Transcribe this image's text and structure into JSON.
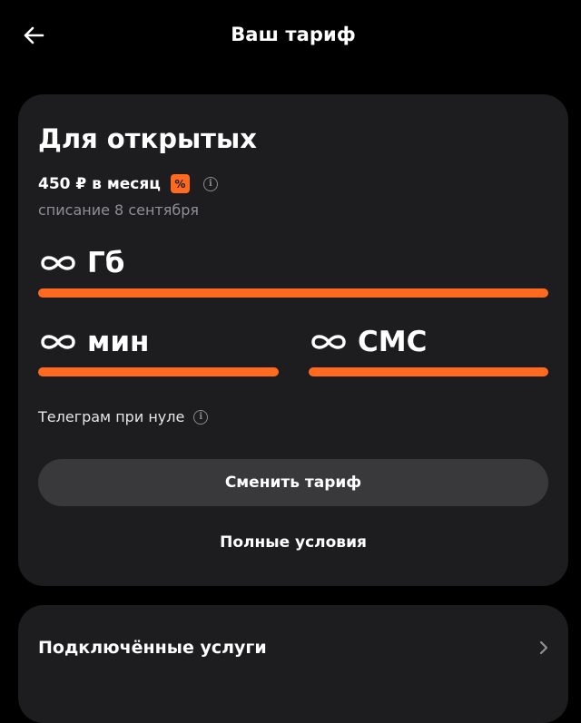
{
  "header": {
    "title": "Ваш тариф"
  },
  "tariff": {
    "name": "Для открытых",
    "price": "450 ₽ в месяц",
    "discount_badge": "%",
    "info_glyph": "i",
    "charge_date": "списание 8 сентября",
    "data_quota": "Гб",
    "minutes_quota": "мин",
    "sms_quota": "СМС",
    "quota_fill": 1.0,
    "perk": "Телеграм при нуле",
    "change_button": "Сменить тариф",
    "terms_link": "Полные условия"
  },
  "services": {
    "title": "Подключённые услуги"
  },
  "colors": {
    "background": "#000000",
    "card": "#1d1d1f",
    "accent": "#ff6a1f",
    "button": "#39393c",
    "muted_text": "#8f8f94"
  },
  "icons": {
    "back": "arrow-left-icon",
    "discount": "percent-icon",
    "info": "info-icon",
    "infinity": "infinity-icon",
    "chevron": "chevron-right-icon"
  }
}
